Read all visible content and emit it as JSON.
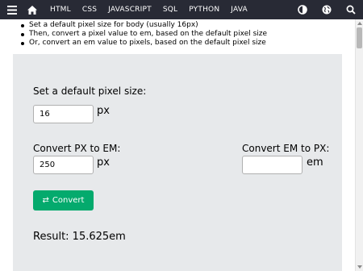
{
  "nav": {
    "links": [
      "HTML",
      "CSS",
      "JAVASCRIPT",
      "SQL",
      "PYTHON",
      "JAVA"
    ],
    "icons": [
      "menu-icon",
      "home-icon",
      "contrast-icon",
      "globe-icon",
      "search-icon"
    ],
    "background": "#282A35"
  },
  "bullets": [
    "Set a default pixel size for body (usually 16px)",
    "Then, convert a pixel value to em, based on the default pixel size",
    "Or, convert an em value to pixels, based on the default pixel size"
  ],
  "converter": {
    "default_label": "Set a default pixel size:",
    "default_value": "16",
    "default_unit": "px",
    "px_to_em_label": "Convert PX to EM:",
    "px_value": "250",
    "px_unit": "px",
    "em_to_px_label": "Convert EM to PX:",
    "em_value": "",
    "em_unit": "em",
    "convert_label": "Convert",
    "result_text": "Result: 15.625em",
    "panel_color": "#E7E9EB",
    "button_color": "#04AA6D"
  }
}
